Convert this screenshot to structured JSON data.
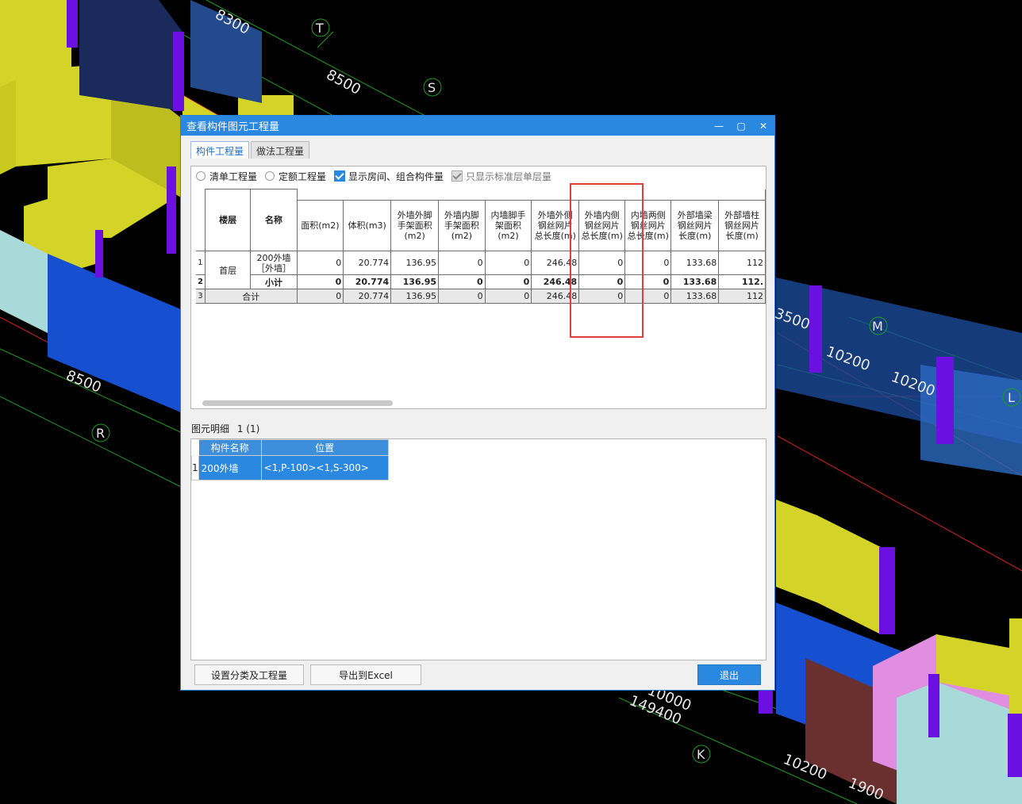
{
  "background": {
    "dimension_labels": [
      "8300",
      "8500",
      "8500",
      "3500",
      "10200",
      "10200",
      "149400",
      "10000",
      "1900",
      "10200"
    ],
    "axis_labels": [
      "T",
      "S",
      "R",
      "M",
      "L",
      "K"
    ]
  },
  "dialog": {
    "title": "查看构件图元工程量",
    "tabs": [
      "构件工程量",
      "做法工程量"
    ],
    "options": {
      "radio1": "清单工程量",
      "radio2": "定额工程量",
      "check1": "显示房间、组合构件量",
      "check2": "只显示标准层单层量"
    },
    "table": {
      "headers": [
        "楼层",
        "名称",
        "面积(m2)",
        "体积(m3)",
        "外墙外脚手架面积(m2)",
        "外墙内脚手架面积(m2)",
        "内墙脚手架面积(m2)",
        "外墙外侧钢丝网片总长度(m)",
        "外墙内侧钢丝网片总长度(m)",
        "内墙两侧钢丝网片总长度(m)",
        "外部墙梁钢丝网片长度(m)",
        "外部墙柱钢丝网片长度(m)"
      ],
      "rows": [
        {
          "no": "1",
          "floor": "首层",
          "name": "200外墙［外墙］",
          "vals": [
            "0",
            "20.774",
            "136.95",
            "0",
            "0",
            "246.48",
            "0",
            "0",
            "133.68",
            "112"
          ]
        },
        {
          "no": "2",
          "name": "小计",
          "vals": [
            "0",
            "20.774",
            "136.95",
            "0",
            "0",
            "246.48",
            "0",
            "0",
            "133.68",
            "112."
          ]
        },
        {
          "no": "3",
          "name": "合计",
          "vals": [
            "0",
            "20.774",
            "136.95",
            "0",
            "0",
            "246.48",
            "0",
            "0",
            "133.68",
            "112"
          ]
        }
      ]
    },
    "detail": {
      "label": "图元明细",
      "count": "1 (1)",
      "headers": [
        "构件名称",
        "位置"
      ],
      "rows": [
        {
          "no": "1",
          "name": "200外墙",
          "position": "<1,P-100><1,S-300>"
        }
      ]
    },
    "buttons": {
      "settings": "设置分类及工程量",
      "export": "导出到Excel",
      "exit": "退出"
    }
  },
  "colors": {
    "wall_yellow": "#d4d428",
    "column_purple": "#6a10e0",
    "wall_blue": "#1650d0",
    "dialog_blue": "#2b88e0",
    "highlight_red": "#e0403a"
  }
}
